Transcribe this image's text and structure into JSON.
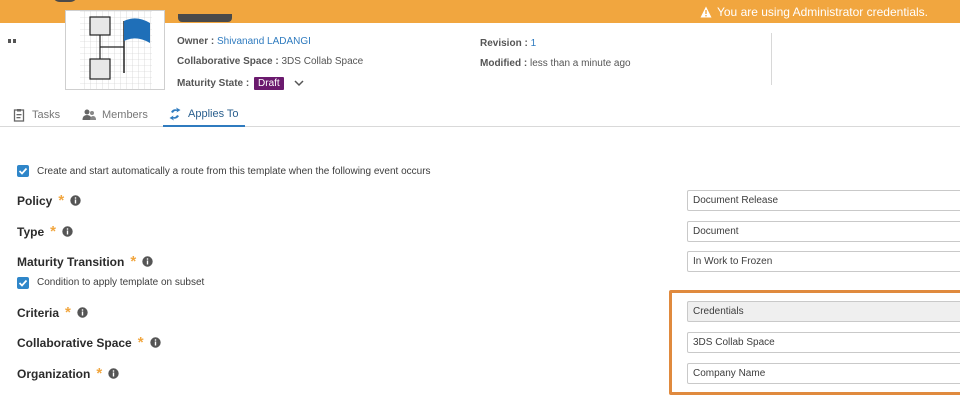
{
  "banner": {
    "message": "You are using Administrator credentials."
  },
  "header": {
    "owner_label": "Owner :",
    "owner_value": "Shivanand LADANGI",
    "collab_label": "Collaborative Space :",
    "collab_value": "3DS Collab Space",
    "maturity_label": "Maturity State :",
    "maturity_value": "Draft",
    "revision_label": "Revision :",
    "revision_value": "1",
    "modified_label": "Modified :",
    "modified_value": "less than a minute ago"
  },
  "tabs": [
    {
      "label": "Tasks",
      "icon": "clipboard-icon",
      "active": false
    },
    {
      "label": "Members",
      "icon": "members-icon",
      "active": false
    },
    {
      "label": "Applies To",
      "icon": "applies-to-icon",
      "active": true
    }
  ],
  "form": {
    "auto_route_checkbox": {
      "label": "Create and start automatically a route from this template when the following event occurs",
      "checked": true
    },
    "subset_checkbox": {
      "label": "Condition to apply template on subset",
      "checked": true
    },
    "required_marker": "*",
    "fields": {
      "policy": {
        "label": "Policy",
        "value": "Document Release"
      },
      "type": {
        "label": "Type",
        "value": "Document"
      },
      "maturity_transition": {
        "label": "Maturity Transition",
        "value": "In Work to Frozen"
      },
      "criteria": {
        "label": "Criteria",
        "value": "Credentials"
      },
      "collaborative_space": {
        "label": "Collaborative Space",
        "value": "3DS Collab Space"
      },
      "organization": {
        "label": "Organization",
        "value": "Company Name"
      }
    }
  },
  "colors": {
    "banner": "#f1a63f",
    "link": "#2f7bbf",
    "draft_badge": "#6b1a6e",
    "checkbox": "#2f86c9",
    "highlight": "#e08a3e"
  }
}
